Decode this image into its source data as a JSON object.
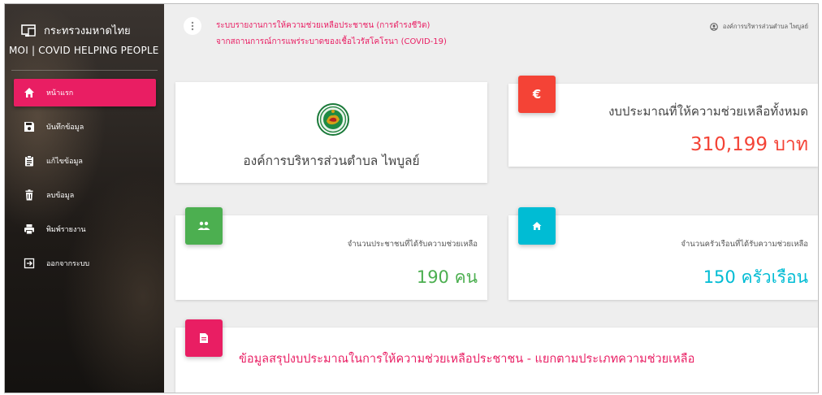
{
  "colors": {
    "accent": "#e91e63",
    "red": "#f44336",
    "green": "#4caf50",
    "cyan": "#00bcd4"
  },
  "sidebar": {
    "brand_title": "กระทรวงมหาดไทย",
    "brand_subtitle": "MOI | COVID HELPING PEOPLE",
    "brand_icon": "monitor-icon",
    "items": [
      {
        "label": "หน้าแรก",
        "icon": "home-icon",
        "active": true
      },
      {
        "label": "บันทึกข้อมูล",
        "icon": "save-icon",
        "active": false
      },
      {
        "label": "แก้ไขข้อมูล",
        "icon": "clipboard-icon",
        "active": false
      },
      {
        "label": "ลบข้อมูล",
        "icon": "trash-icon",
        "active": false
      },
      {
        "label": "พิมพ์รายงาน",
        "icon": "printer-icon",
        "active": false
      },
      {
        "label": "ออกจากระบบ",
        "icon": "logout-icon",
        "active": false
      }
    ]
  },
  "header": {
    "title_line1": "ระบบรายงานการให้ความช่วยเหลือประชาชน (การดำรงชีวิต)",
    "title_line2": "จากสถานการณ์การแพร่ระบาดของเชื้อไวรัสโคโรนา (COVID-19)",
    "user": "องค์การบริหารส่วนตำบล ไพบูลย์"
  },
  "cards": {
    "org": {
      "name": "องค์การบริหารส่วนตำบล ไพบูลย์"
    },
    "budget": {
      "label": "งบประมาณที่ให้ความช่วยเหลือทั้งหมด",
      "value": "310,199 บาท",
      "icon": "euro-icon"
    },
    "people": {
      "label": "จำนวนประชาชนที่ได้รับความช่วยเหลือ",
      "value": "190 คน",
      "icon": "people-icon"
    },
    "households": {
      "label": "จำนวนครัวเรือนที่ได้รับความช่วยเหลือ",
      "value": "150 ครัวเรือน",
      "icon": "house-icon"
    },
    "summary": {
      "label": "ข้อมูลสรุปงบประมาณในการให้ความช่วยเหลือประชาชน - แยกตามประเภทความช่วยเหลือ",
      "icon": "document-icon"
    }
  }
}
